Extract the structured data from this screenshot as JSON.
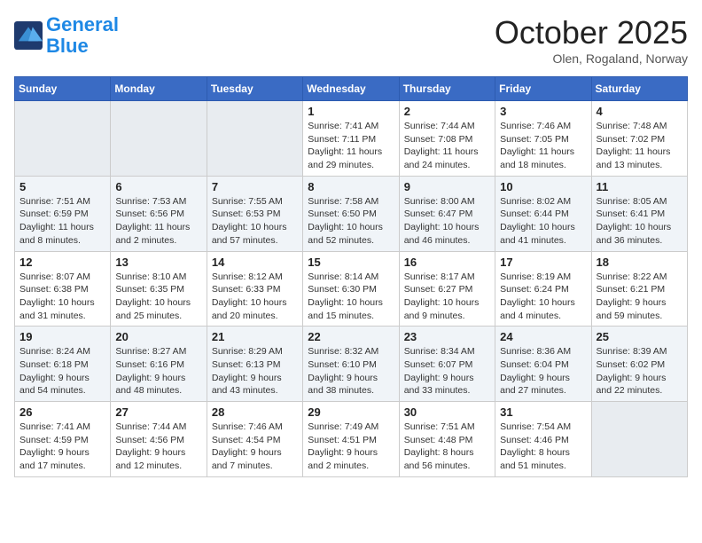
{
  "logo": {
    "line1": "General",
    "line2": "Blue"
  },
  "title": "October 2025",
  "location": "Olen, Rogaland, Norway",
  "days_of_week": [
    "Sunday",
    "Monday",
    "Tuesday",
    "Wednesday",
    "Thursday",
    "Friday",
    "Saturday"
  ],
  "weeks": [
    [
      {
        "day": "",
        "info": ""
      },
      {
        "day": "",
        "info": ""
      },
      {
        "day": "",
        "info": ""
      },
      {
        "day": "1",
        "info": "Sunrise: 7:41 AM\nSunset: 7:11 PM\nDaylight: 11 hours and 29 minutes."
      },
      {
        "day": "2",
        "info": "Sunrise: 7:44 AM\nSunset: 7:08 PM\nDaylight: 11 hours and 24 minutes."
      },
      {
        "day": "3",
        "info": "Sunrise: 7:46 AM\nSunset: 7:05 PM\nDaylight: 11 hours and 18 minutes."
      },
      {
        "day": "4",
        "info": "Sunrise: 7:48 AM\nSunset: 7:02 PM\nDaylight: 11 hours and 13 minutes."
      }
    ],
    [
      {
        "day": "5",
        "info": "Sunrise: 7:51 AM\nSunset: 6:59 PM\nDaylight: 11 hours and 8 minutes."
      },
      {
        "day": "6",
        "info": "Sunrise: 7:53 AM\nSunset: 6:56 PM\nDaylight: 11 hours and 2 minutes."
      },
      {
        "day": "7",
        "info": "Sunrise: 7:55 AM\nSunset: 6:53 PM\nDaylight: 10 hours and 57 minutes."
      },
      {
        "day": "8",
        "info": "Sunrise: 7:58 AM\nSunset: 6:50 PM\nDaylight: 10 hours and 52 minutes."
      },
      {
        "day": "9",
        "info": "Sunrise: 8:00 AM\nSunset: 6:47 PM\nDaylight: 10 hours and 46 minutes."
      },
      {
        "day": "10",
        "info": "Sunrise: 8:02 AM\nSunset: 6:44 PM\nDaylight: 10 hours and 41 minutes."
      },
      {
        "day": "11",
        "info": "Sunrise: 8:05 AM\nSunset: 6:41 PM\nDaylight: 10 hours and 36 minutes."
      }
    ],
    [
      {
        "day": "12",
        "info": "Sunrise: 8:07 AM\nSunset: 6:38 PM\nDaylight: 10 hours and 31 minutes."
      },
      {
        "day": "13",
        "info": "Sunrise: 8:10 AM\nSunset: 6:35 PM\nDaylight: 10 hours and 25 minutes."
      },
      {
        "day": "14",
        "info": "Sunrise: 8:12 AM\nSunset: 6:33 PM\nDaylight: 10 hours and 20 minutes."
      },
      {
        "day": "15",
        "info": "Sunrise: 8:14 AM\nSunset: 6:30 PM\nDaylight: 10 hours and 15 minutes."
      },
      {
        "day": "16",
        "info": "Sunrise: 8:17 AM\nSunset: 6:27 PM\nDaylight: 10 hours and 9 minutes."
      },
      {
        "day": "17",
        "info": "Sunrise: 8:19 AM\nSunset: 6:24 PM\nDaylight: 10 hours and 4 minutes."
      },
      {
        "day": "18",
        "info": "Sunrise: 8:22 AM\nSunset: 6:21 PM\nDaylight: 9 hours and 59 minutes."
      }
    ],
    [
      {
        "day": "19",
        "info": "Sunrise: 8:24 AM\nSunset: 6:18 PM\nDaylight: 9 hours and 54 minutes."
      },
      {
        "day": "20",
        "info": "Sunrise: 8:27 AM\nSunset: 6:16 PM\nDaylight: 9 hours and 48 minutes."
      },
      {
        "day": "21",
        "info": "Sunrise: 8:29 AM\nSunset: 6:13 PM\nDaylight: 9 hours and 43 minutes."
      },
      {
        "day": "22",
        "info": "Sunrise: 8:32 AM\nSunset: 6:10 PM\nDaylight: 9 hours and 38 minutes."
      },
      {
        "day": "23",
        "info": "Sunrise: 8:34 AM\nSunset: 6:07 PM\nDaylight: 9 hours and 33 minutes."
      },
      {
        "day": "24",
        "info": "Sunrise: 8:36 AM\nSunset: 6:04 PM\nDaylight: 9 hours and 27 minutes."
      },
      {
        "day": "25",
        "info": "Sunrise: 8:39 AM\nSunset: 6:02 PM\nDaylight: 9 hours and 22 minutes."
      }
    ],
    [
      {
        "day": "26",
        "info": "Sunrise: 7:41 AM\nSunset: 4:59 PM\nDaylight: 9 hours and 17 minutes."
      },
      {
        "day": "27",
        "info": "Sunrise: 7:44 AM\nSunset: 4:56 PM\nDaylight: 9 hours and 12 minutes."
      },
      {
        "day": "28",
        "info": "Sunrise: 7:46 AM\nSunset: 4:54 PM\nDaylight: 9 hours and 7 minutes."
      },
      {
        "day": "29",
        "info": "Sunrise: 7:49 AM\nSunset: 4:51 PM\nDaylight: 9 hours and 2 minutes."
      },
      {
        "day": "30",
        "info": "Sunrise: 7:51 AM\nSunset: 4:48 PM\nDaylight: 8 hours and 56 minutes."
      },
      {
        "day": "31",
        "info": "Sunrise: 7:54 AM\nSunset: 4:46 PM\nDaylight: 8 hours and 51 minutes."
      },
      {
        "day": "",
        "info": ""
      }
    ]
  ]
}
